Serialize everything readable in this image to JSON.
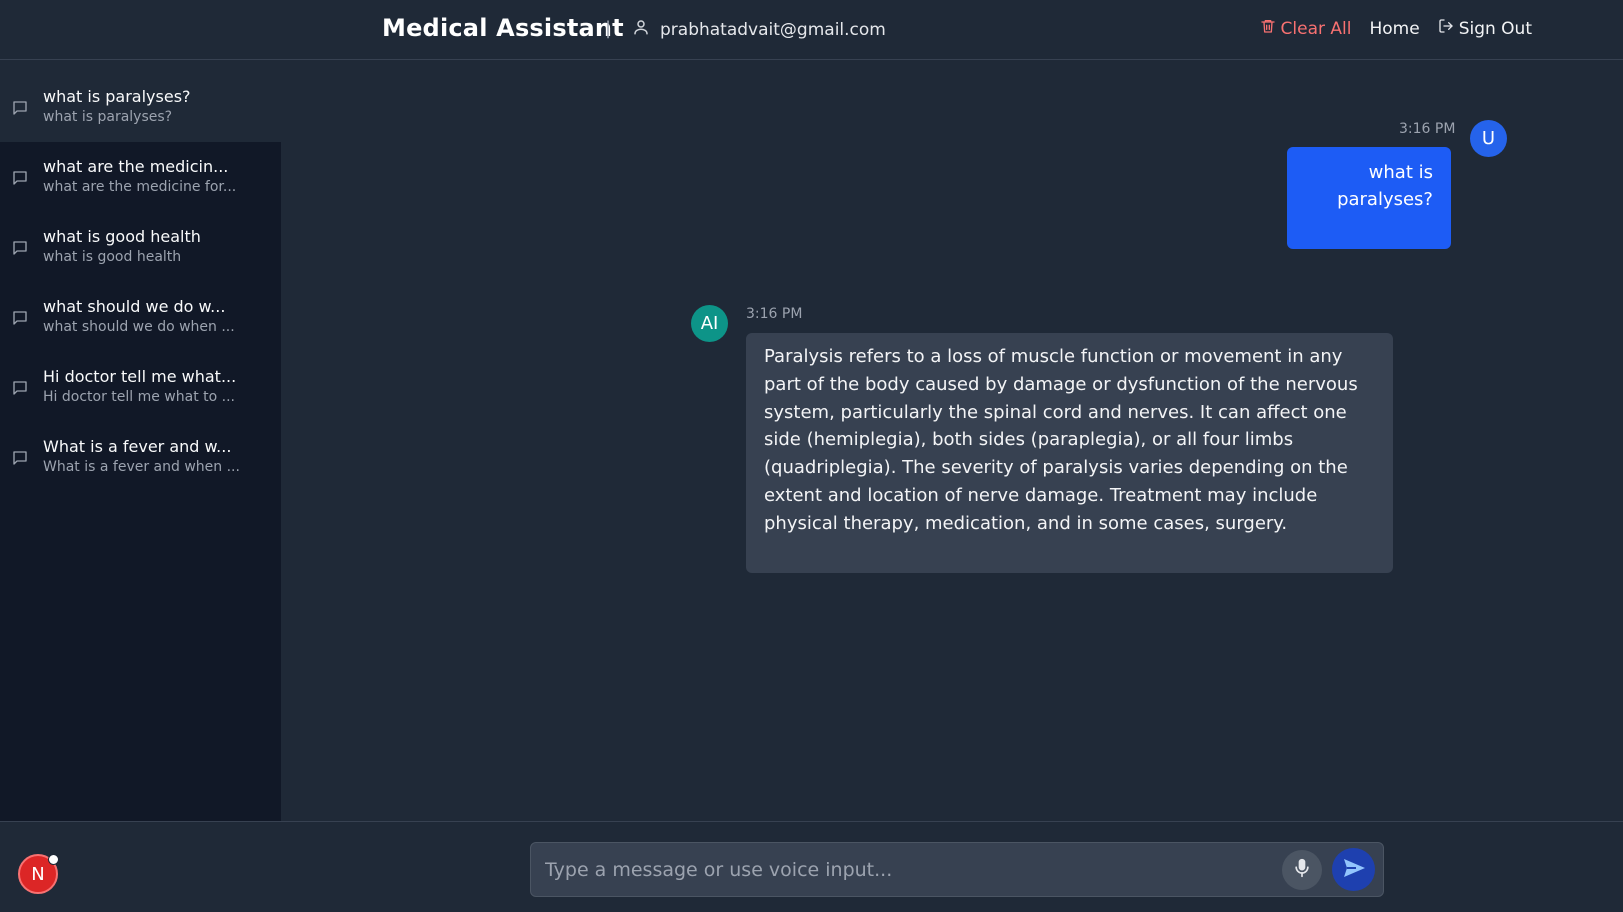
{
  "header": {
    "title": "Medical Assistant",
    "separator": "|",
    "user_email": "prabhatadvait@gmail.com",
    "nav": {
      "clear_all": "Clear All",
      "home": "Home",
      "sign_out": "Sign Out"
    }
  },
  "sidebar": {
    "conversations": [
      {
        "title": "what is paralyses?",
        "preview": "what is paralyses?",
        "active": true
      },
      {
        "title": "what are the medicin...",
        "preview": "what are the medicine for...",
        "active": false
      },
      {
        "title": "what is good health",
        "preview": "what is good health",
        "active": false
      },
      {
        "title": "what should we do w...",
        "preview": "what should we do when ...",
        "active": false
      },
      {
        "title": "Hi doctor tell me what...",
        "preview": "Hi doctor tell me what to ...",
        "active": false
      },
      {
        "title": "What is a fever and w...",
        "preview": "What is a fever and when ...",
        "active": false
      }
    ]
  },
  "chat": {
    "messages": [
      {
        "role": "user",
        "avatar": "U",
        "time": "3:16 PM",
        "text": "what is paralyses?"
      },
      {
        "role": "ai",
        "avatar": "AI",
        "time": "3:16 PM",
        "text": " Paralysis refers to a loss of muscle function or movement in any part of the body caused by damage or dysfunction of the nervous system, particularly the spinal cord and nerves. It can affect one side (hemiplegia), both sides (paraplegia), or all four limbs (quadriplegia). The severity of paralysis varies depending on the extent and location of nerve damage. Treatment may include physical therapy, medication, and in some cases, surgery."
      }
    ]
  },
  "footer": {
    "account_avatar": "N",
    "input_placeholder": "Type a message or use voice input...",
    "input_value": ""
  },
  "icons": {
    "user": "user-icon",
    "clear": "trash-icon",
    "signout": "sign-out-icon",
    "conversation": "message-square-icon",
    "mic": "microphone-icon",
    "send": "send-icon"
  },
  "colors": {
    "background": "#1f2937",
    "sidebar": "#111827",
    "user_bubble": "#1d5cf5",
    "ai_bubble": "#374151",
    "ai_avatar": "#0d9488",
    "user_avatar": "#2563eb",
    "danger": "#f87171",
    "send_button": "#1e40af"
  }
}
